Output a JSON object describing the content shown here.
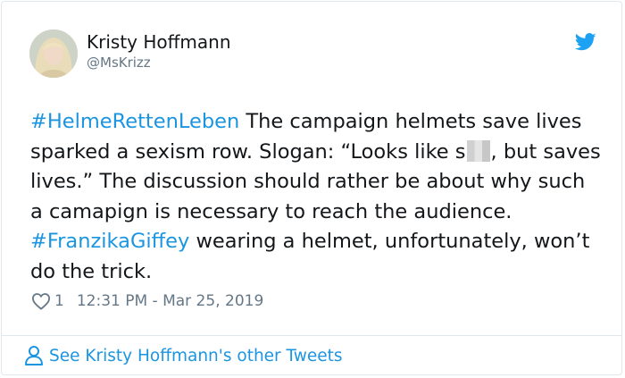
{
  "author": {
    "display_name": "Kristy Hoffmann",
    "handle": "@MsKrizz"
  },
  "tweet": {
    "hashtag1": "#HelmeRettenLeben",
    "text1": " The campaign helmets save lives sparked a sexism row. Slogan: “Looks like s",
    "text2": ", but saves lives.” The discussion should rather be about why such a camapign is necessary to reach the audience. ",
    "hashtag2": "#FranzikaGiffey",
    "text3": " wearing a helmet, unfortunately, won’t do the trick."
  },
  "meta": {
    "like_count": "1",
    "timestamp": "12:31 PM - Mar 25, 2019"
  },
  "footer": {
    "link_label": "See Kristy Hoffmann's other Tweets"
  },
  "colors": {
    "link": "#1b95e0",
    "twitter_blue": "#1da1f2",
    "muted": "#657786"
  },
  "icons": {
    "brand": "twitter-bird-icon",
    "like": "heart-icon",
    "profile": "person-icon"
  }
}
